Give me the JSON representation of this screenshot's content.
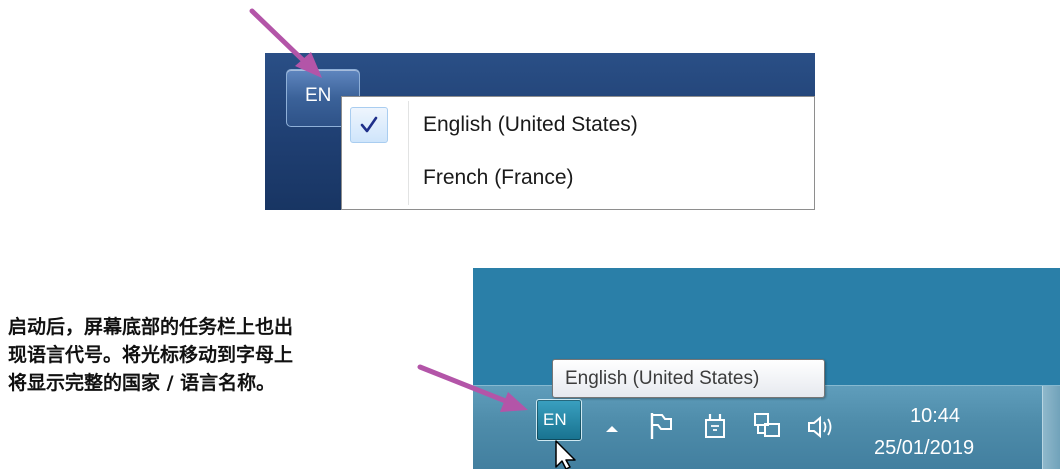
{
  "top_panel": {
    "language_button": "EN",
    "menu": {
      "items": [
        {
          "label": "English (United States)",
          "checked": true
        },
        {
          "label": "French (France)",
          "checked": false
        }
      ]
    }
  },
  "bottom_panel": {
    "tooltip": "English (United States)",
    "language_button": "EN",
    "tray_icons": [
      "show-hidden-icons-triangle-icon",
      "action-center-flag-icon",
      "power-plug-icon",
      "network-icon",
      "speaker-volume-icon"
    ],
    "clock": {
      "time": "10:44",
      "date": "25/01/2019"
    }
  },
  "caption": {
    "lines": [
      "启动后，屏幕底部的任务栏上也出",
      "现语言代号。将光标移动到字母上",
      "将显示完整的国家 / 语言名称。"
    ]
  },
  "colors": {
    "annotation_arrow": "#b355a8",
    "desktop_blue": "#2a7fa8",
    "taskbar": "#4e8caa",
    "menu_check": "#1f2f8a"
  }
}
